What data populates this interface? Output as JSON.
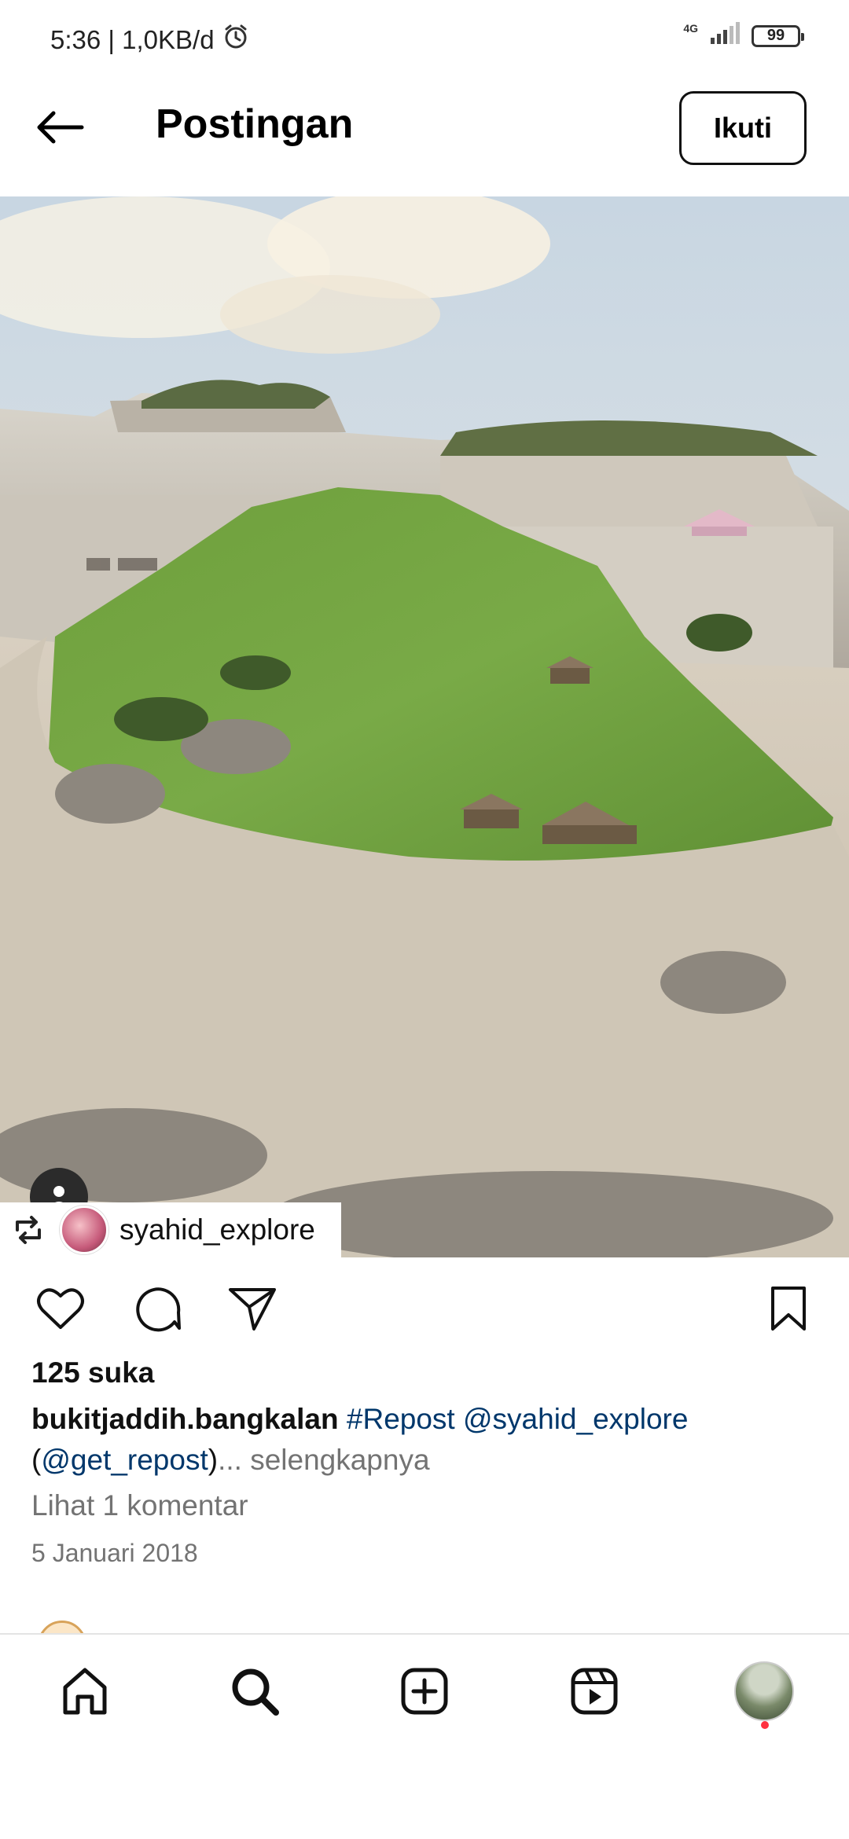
{
  "status_bar": {
    "time_speed": "5:36 | 1,0KB/d",
    "network": "4G",
    "battery": "99",
    "icons": [
      "alarm-icon",
      "signal-icon",
      "battery-icon"
    ]
  },
  "header": {
    "title": "Postingan",
    "follow_label": "Ikuti",
    "back_icon": "back-arrow-icon"
  },
  "post": {
    "repost_user": "syahid_explore",
    "likes": "125 suka",
    "caption": {
      "user": "bukitjaddih.bangkalan",
      "tag1": "#Repost",
      "mention1": "@syahid_explore",
      "paren_open": "(",
      "mention2": "@get_repost",
      "paren_close": ")",
      "more": "... selengkapnya"
    },
    "comments_link": "Lihat 1 komentar",
    "date": "5 Januari 2018"
  },
  "actions": [
    "like-icon",
    "comment-icon",
    "share-icon",
    "save-icon"
  ],
  "bottom_nav": [
    "home-icon",
    "search-icon",
    "create-icon",
    "reels-icon",
    "profile-avatar"
  ],
  "colors": {
    "link": "#00376b",
    "muted": "#737373",
    "notification_dot": "#ff3040"
  }
}
